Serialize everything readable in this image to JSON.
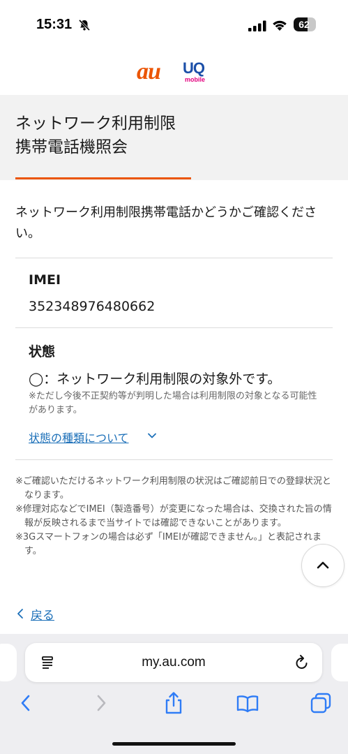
{
  "status_bar": {
    "time": "15:31",
    "battery_level": "62",
    "battery_fraction": 0.62
  },
  "brand": {
    "au": "au",
    "uq": "UQ",
    "uq_sub": "mobile"
  },
  "page": {
    "title_line1": "ネットワーク利用制限",
    "title_line2": "携帯電話機照会",
    "intro": "ネットワーク利用制限携帯電話かどうかご確認ください。"
  },
  "imei": {
    "label": "IMEI",
    "value": "352348976480662"
  },
  "status": {
    "label": "状態",
    "value": "◯：ネットワーク利用制限の対象外です。",
    "note": "※ただし今後不正契約等が判明した場合は利用制限の対象となる可能性があります。",
    "link": "状態の種類について"
  },
  "notes": [
    "※ご確認いただけるネットワーク利用制限の状況はご確認前日での登録状況となります。",
    "※修理対応などでIMEI（製造番号）が変更になった場合は、交換された旨の情報が反映されるまで当サイトでは確認できないことがあります。",
    "※3Gスマートフォンの場合は必ず「IMEIが確認できません。」と表記されます。"
  ],
  "back_link": "戻る",
  "browser": {
    "url": "my.au.com"
  },
  "colors": {
    "accent": "#eb5505",
    "link": "#1b6fb8",
    "uq_blue": "#1b4fa8",
    "uq_pink": "#e4007f"
  },
  "icons": [
    "bell-slash-icon",
    "cellular-signal-icon",
    "wifi-icon",
    "battery-icon",
    "chevron-down-icon",
    "chevron-up-icon",
    "chevron-left-icon",
    "reader-icon",
    "reload-icon",
    "back-icon",
    "forward-icon",
    "share-icon",
    "bookmarks-icon",
    "tabs-icon"
  ]
}
